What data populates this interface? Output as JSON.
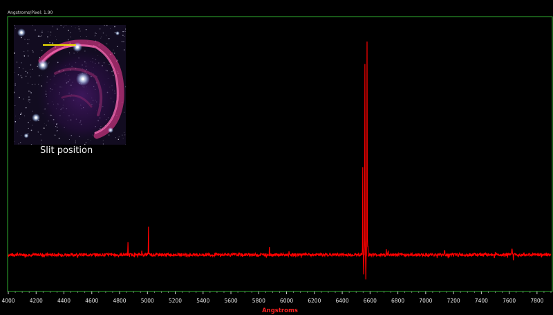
{
  "header": {
    "scale_text": "Angstroms/Pixel: 1.90"
  },
  "colors": {
    "frame": "#2fae2f",
    "spectrum": "#ff0000",
    "axis_title": "#ff2020",
    "tick_text": "#e8e8e8",
    "slit_marker": "#f2e600"
  },
  "inset": {
    "caption": "Slit position",
    "image": "nebula-image",
    "marker": "slit-marker-line"
  },
  "chart_data": {
    "type": "line",
    "xlabel": "Angstroms",
    "ylabel": "",
    "title": "",
    "xlim": [
      4000,
      7900
    ],
    "ylim": [
      -25,
      310
    ],
    "grid": false,
    "x_ticks": [
      4000,
      4200,
      4400,
      4600,
      4800,
      5000,
      5200,
      5400,
      5600,
      5800,
      6000,
      6200,
      6400,
      6600,
      6800,
      7000,
      7200,
      7400,
      7600,
      7800
    ],
    "noise_amplitude": 2.2,
    "series": [
      {
        "baseline": 0,
        "peaks": [
          {
            "x": 4861,
            "y": 18
          },
          {
            "x": 4959,
            "y": 6
          },
          {
            "x": 5007,
            "y": 40
          },
          {
            "x": 5876,
            "y": 11
          },
          {
            "x": 6548,
            "y": 125
          },
          {
            "x": 6555,
            "y": -28
          },
          {
            "x": 6563,
            "y": 272
          },
          {
            "x": 6570,
            "y": -35
          },
          {
            "x": 6578,
            "y": 304
          },
          {
            "x": 6584,
            "y": 12
          },
          {
            "x": 6717,
            "y": 8
          },
          {
            "x": 6731,
            "y": 6
          },
          {
            "x": 7136,
            "y": 6
          },
          {
            "x": 7500,
            "y": 4
          },
          {
            "x": 7620,
            "y": 8
          },
          {
            "x": 7630,
            "y": -8
          }
        ]
      }
    ]
  }
}
